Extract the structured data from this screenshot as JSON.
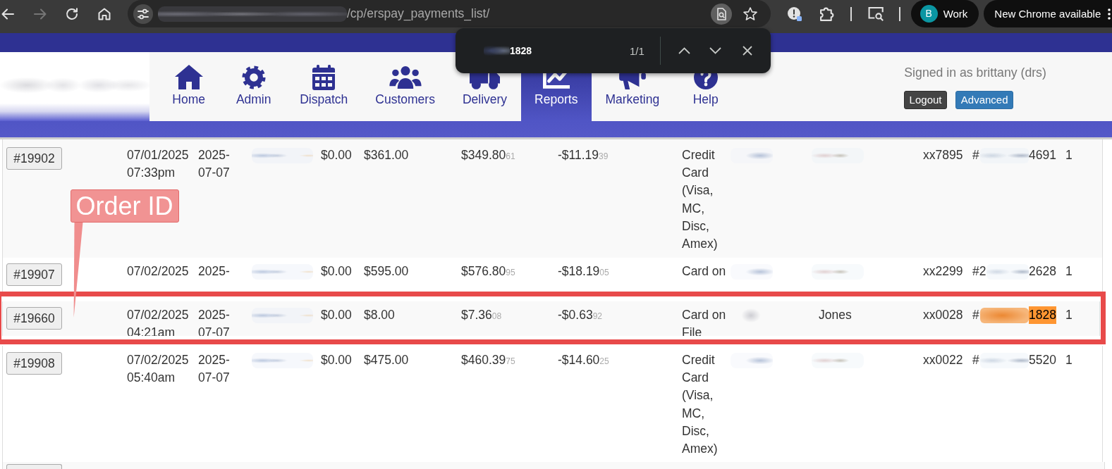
{
  "browser": {
    "nav_buttons": [
      {
        "kind": "back",
        "disabled": false
      },
      {
        "kind": "forward",
        "disabled": true
      },
      {
        "kind": "reload",
        "disabled": false
      },
      {
        "kind": "home",
        "disabled": false
      }
    ],
    "url_path": "/cp/erspay_payments_list/",
    "profile": {
      "initial": "B",
      "label": "Work"
    },
    "update_button": "New Chrome available"
  },
  "find_bar": {
    "query_end": "1828",
    "count": "1/1"
  },
  "header": {
    "nav": [
      {
        "kind": "home",
        "label": "Home",
        "selected": false
      },
      {
        "kind": "admin",
        "label": "Admin",
        "selected": false
      },
      {
        "kind": "dispatch",
        "label": "Dispatch",
        "selected": false
      },
      {
        "kind": "customers",
        "label": "Customers",
        "selected": false
      },
      {
        "kind": "delivery",
        "label": "Delivery",
        "selected": false
      },
      {
        "kind": "reports",
        "label": "Reports",
        "selected": true
      },
      {
        "kind": "marketing",
        "label": "Marketing",
        "selected": false
      },
      {
        "kind": "help",
        "label": "Help",
        "selected": false
      }
    ],
    "signed_in": "Signed in as brittany (drs)",
    "buttons": [
      {
        "kind": "dark",
        "label": "Logout"
      },
      {
        "kind": "primary",
        "label": "Advanced"
      }
    ]
  },
  "table": {
    "rows": [
      {
        "order": "#19902",
        "created": "07/01/2025 07:33pm",
        "date": "2025-07-07",
        "amount_1": "$0.00",
        "amount_2": "$361.00",
        "amount_3": {
          "value": "$349.80",
          "extra": "61"
        },
        "amount_4": {
          "value": "-$11.19",
          "extra": "39"
        },
        "method": "Credit Card (Visa, MC, Disc, Amex)",
        "card": "xx7895",
        "reference": {
          "prefix": "#",
          "suffix": "4691",
          "found": false
        },
        "count": "1",
        "clipped": false,
        "outlined": false
      },
      {
        "order": "#19907",
        "created": "07/02/2025",
        "date": "2025-",
        "amount_1": "$0.00",
        "amount_2": "$595.00",
        "amount_3": {
          "value": "$576.80",
          "extra": "95"
        },
        "amount_4": {
          "value": "-$18.19",
          "extra": "05"
        },
        "method": "Card on",
        "card": "xx2299",
        "reference": {
          "prefix": "#2",
          "suffix": "2628",
          "found": false
        },
        "count": "1",
        "clipped": true,
        "outlined": false
      },
      {
        "order": "#19660",
        "created": "07/02/2025 04:21am",
        "date": "2025-07-07",
        "amount_1": "$0.00",
        "amount_2": "$8.00",
        "amount_3": {
          "value": "$7.36",
          "extra": "08"
        },
        "amount_4": {
          "value": "-$0.63",
          "extra": "92"
        },
        "method": "Card on File",
        "name": "Jones",
        "card": "xx0028",
        "reference": {
          "prefix": "#",
          "suffix": "1828",
          "found": true
        },
        "count": "1",
        "clipped": true,
        "outlined": true
      },
      {
        "order": "#19908",
        "created": "07/02/2025 05:40am",
        "date": "2025-07-07",
        "amount_1": "$0.00",
        "amount_2": "$475.00",
        "amount_3": {
          "value": "$460.39",
          "extra": "75"
        },
        "amount_4": {
          "value": "-$14.60",
          "extra": "25"
        },
        "method": "Credit Card (Visa, MC, Disc, Amex)",
        "card": "xx0022",
        "reference": {
          "prefix": "#",
          "suffix": "5520",
          "found": false
        },
        "count": "1",
        "clipped": false,
        "outlined": false
      }
    ]
  },
  "annotation": {
    "label": "Order ID"
  }
}
